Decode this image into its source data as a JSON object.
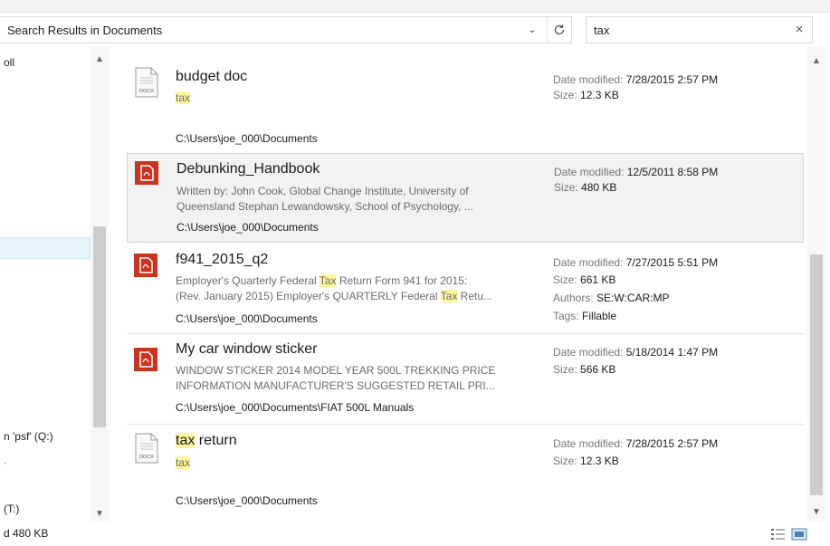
{
  "address": {
    "path": "Search Results in Documents"
  },
  "search": {
    "query": "tax",
    "clear_glyph": "×"
  },
  "nav": {
    "items": [
      "oll",
      "n 'psf' (Q:)",
      "(T:)"
    ]
  },
  "status": {
    "text": "d  480 KB"
  },
  "results": [
    {
      "name": "budget doc",
      "type": "docx",
      "icon_label": "DOCX",
      "snippet_lines": [
        [
          {
            "t": "tax",
            "hl": true
          }
        ]
      ],
      "path": "C:\\Users\\joe_000\\Documents",
      "meta": [
        {
          "label": "Date modified:",
          "value": "7/28/2015 2:57 PM"
        },
        {
          "label": "Size:",
          "value": "12.3 KB"
        }
      ]
    },
    {
      "name": "Debunking_Handbook",
      "type": "pdf",
      "selected": true,
      "snippet_lines": [
        [
          {
            "t": "Written by: John Cook, Global Change Institute, University of"
          }
        ],
        [
          {
            "t": "Queensland Stephan Lewandowsky, School of Psychology, ..."
          }
        ]
      ],
      "path": "C:\\Users\\joe_000\\Documents",
      "meta": [
        {
          "label": "Date modified:",
          "value": "12/5/2011 8:58 PM"
        },
        {
          "label": "Size:",
          "value": "480 KB"
        }
      ]
    },
    {
      "name": "f941_2015_q2",
      "type": "pdf",
      "snippet_lines": [
        [
          {
            "t": "Employer's Quarterly Federal "
          },
          {
            "t": "Tax",
            "hl": true
          },
          {
            "t": " Return Form 941 for 2015:"
          }
        ],
        [
          {
            "t": "(Rev. January 2015) Employer's QUARTERLY Federal "
          },
          {
            "t": "Tax",
            "hl": true
          },
          {
            "t": " Retu..."
          }
        ]
      ],
      "path": "C:\\Users\\joe_000\\Documents",
      "meta": [
        {
          "label": "Date modified:",
          "value": "7/27/2015 5:51 PM"
        },
        {
          "label": "Size:",
          "value": "661 KB"
        },
        {
          "label": "Authors:",
          "value": "SE:W:CAR:MP"
        },
        {
          "label": "Tags:",
          "value": "Fillable"
        }
      ]
    },
    {
      "name": "My car window sticker",
      "type": "pdf",
      "snippet_lines": [
        [
          {
            "t": "WINDOW STICKER 2014 MODEL YEAR 500L TREKKING PRICE"
          }
        ],
        [
          {
            "t": "INFORMATION MANUFACTURER'S SUGGESTED RETAIL PRI..."
          }
        ]
      ],
      "path": "C:\\Users\\joe_000\\Documents\\FIAT 500L Manuals",
      "meta": [
        {
          "label": "Date modified:",
          "value": "5/18/2014 1:47 PM"
        },
        {
          "label": "Size:",
          "value": "566 KB"
        }
      ]
    },
    {
      "name_parts": [
        {
          "t": "tax",
          "hl": true
        },
        {
          "t": " return"
        }
      ],
      "type": "docx",
      "icon_label": "DOCX",
      "snippet_lines": [
        [
          {
            "t": "tax",
            "hl": true
          }
        ]
      ],
      "path": "C:\\Users\\joe_000\\Documents",
      "meta": [
        {
          "label": "Date modified:",
          "value": "7/28/2015 2:57 PM"
        },
        {
          "label": "Size:",
          "value": "12.3 KB"
        }
      ]
    }
  ]
}
